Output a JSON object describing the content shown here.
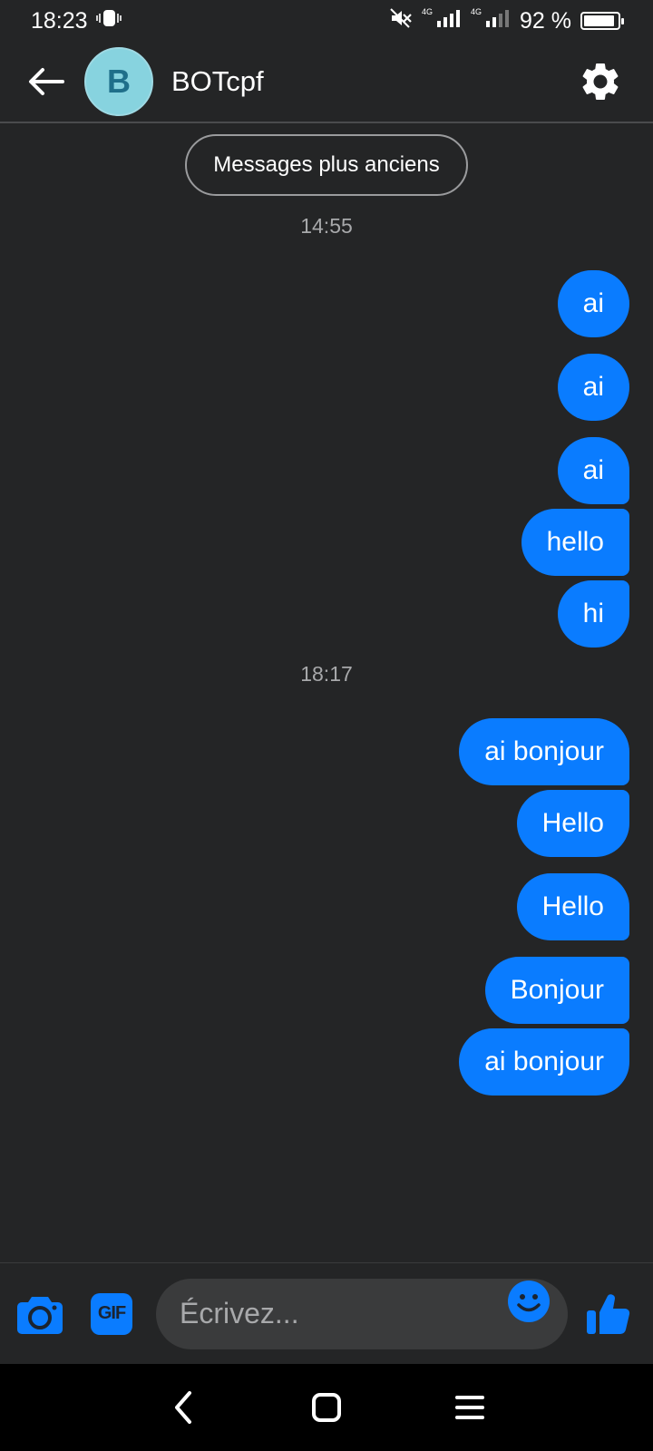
{
  "status_bar": {
    "time": "18:23",
    "signal_label_1": "4G",
    "signal_label_2": "4G",
    "battery_text": "92 %",
    "battery_level": 0.92
  },
  "header": {
    "avatar_letter": "B",
    "contact_name": "BOTcpf"
  },
  "conversation": {
    "older_messages_label": "Messages plus anciens",
    "groups": [
      {
        "timestamp": "14:55",
        "messages": [
          "ai",
          "ai",
          "ai",
          "hello",
          "hi"
        ]
      },
      {
        "timestamp": "18:17",
        "messages": [
          "ai bonjour",
          "Hello",
          "Hello",
          "Bonjour",
          "ai bonjour"
        ]
      }
    ]
  },
  "composer": {
    "gif_label": "GIF",
    "placeholder": "Écrivez...",
    "value": ""
  },
  "colors": {
    "background": "#242526",
    "bubble": "#0a7cff",
    "accent": "#0a7cff",
    "avatar": "#87d3df"
  }
}
